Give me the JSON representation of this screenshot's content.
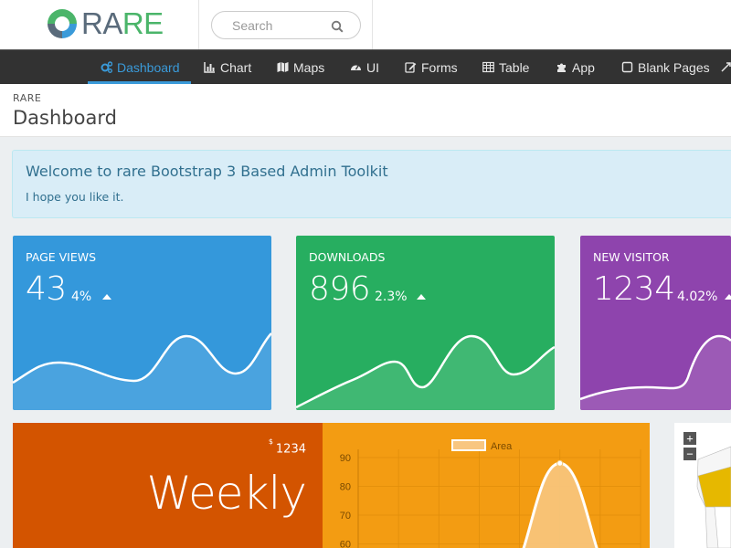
{
  "brand": {
    "part1": "RA",
    "part2": "RE"
  },
  "search": {
    "placeholder": "Search"
  },
  "nav": {
    "active": "Dashboard",
    "items": [
      {
        "label": "Dashboard",
        "icon": "cogs-icon"
      },
      {
        "label": "Chart",
        "icon": "bar-chart-icon"
      },
      {
        "label": "Maps",
        "icon": "map-icon"
      },
      {
        "label": "UI",
        "icon": "dashboard-gauge-icon"
      },
      {
        "label": "Forms",
        "icon": "edit-icon"
      },
      {
        "label": "Table",
        "icon": "table-icon"
      },
      {
        "label": "App",
        "icon": "puzzle-icon"
      },
      {
        "label": "Blank Pages",
        "icon": "square-icon"
      }
    ]
  },
  "page": {
    "breadcrumb": "RARE",
    "title": "Dashboard"
  },
  "alert": {
    "title": "Welcome to rare Bootstrap 3 Based Admin Toolkit",
    "text": "I hope you like it."
  },
  "stats": [
    {
      "label": "PAGE VIEWS",
      "value": "43",
      "percent": "4%",
      "trend": "up",
      "color": "#3498db"
    },
    {
      "label": "DOWNLOADS",
      "value": "896",
      "percent": "2.3%",
      "trend": "up",
      "color": "#27ae60"
    },
    {
      "label": "NEW VISITOR",
      "value": "1234",
      "percent": "4.02%",
      "trend": "up",
      "color": "#8e44ad"
    }
  ],
  "weekly": {
    "currency": "$",
    "amount": "1234",
    "label": "Weekly",
    "color": "#d35400"
  },
  "map": {
    "zoom_in": "+",
    "zoom_out": "−"
  },
  "chart_data": {
    "type": "area",
    "legend": [
      "Area"
    ],
    "yticks": [
      90,
      80,
      70,
      60
    ],
    "ylim": [
      55,
      92
    ],
    "grid": true,
    "legend_position": "top-center",
    "series": [
      {
        "name": "Area",
        "values": [
          55,
          55,
          55,
          55,
          56,
          88,
          56,
          55
        ]
      }
    ],
    "colors": {
      "background": "#f39c12",
      "fill": "#f8c680",
      "line": "#ffffff"
    }
  }
}
